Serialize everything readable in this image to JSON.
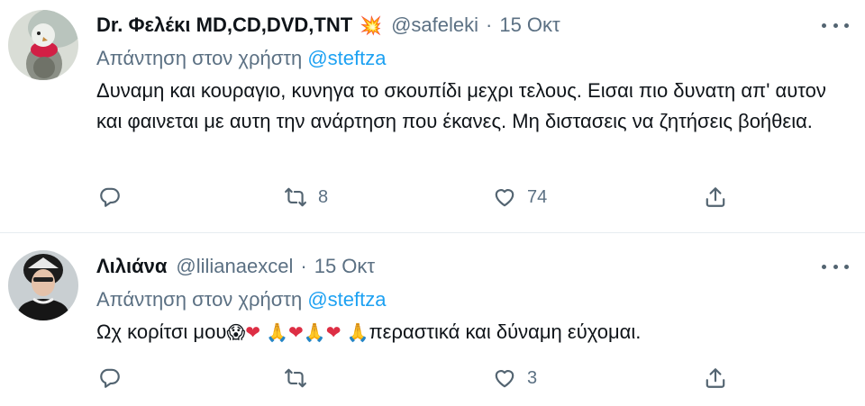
{
  "tweets": [
    {
      "author_name": "Dr. Φελέκι MD,CD,DVD,TNT",
      "badge_emoji": "💥",
      "handle": "@safeleki",
      "separator": "·",
      "date": "15 Οκτ",
      "replying_prefix": "Απάντηση στον χρήστη",
      "replying_to": "@steftza",
      "text": "Δυναμη και κουραγιο, κυνηγα το σκουπίδι μεχρι τελους. Εισαι πιο δυνατη απ' αυτον και φαινεται με αυτη την ανάρτηση που έκανες. Μη διστασεις να ζητήσεις βοήθεια.",
      "retweet_count": "8",
      "like_count": "74"
    },
    {
      "author_name": "Λιλιάνα",
      "handle": "@lilianaexcel",
      "separator": "·",
      "date": "15 Οκτ",
      "replying_prefix": "Απάντηση στον χρήστη",
      "replying_to": "@steftza",
      "text_prefix": "Ωχ κορίτσι μου",
      "emojis": [
        "😱",
        "❤",
        "🙏",
        "❤",
        "🙏",
        "❤",
        "🙏"
      ],
      "text_suffix": "περαστικά και δύναμη εύχομαι.",
      "retweet_count": "",
      "like_count": "3"
    }
  ],
  "icons": {
    "more": "more-dots-icon",
    "reply": "reply-icon",
    "retweet": "retweet-icon",
    "like": "heart-icon",
    "share": "share-icon"
  },
  "colors": {
    "mention": "#1da1f2",
    "secondary_text": "#5b7083",
    "heart_emoji": "#dd2e44"
  }
}
